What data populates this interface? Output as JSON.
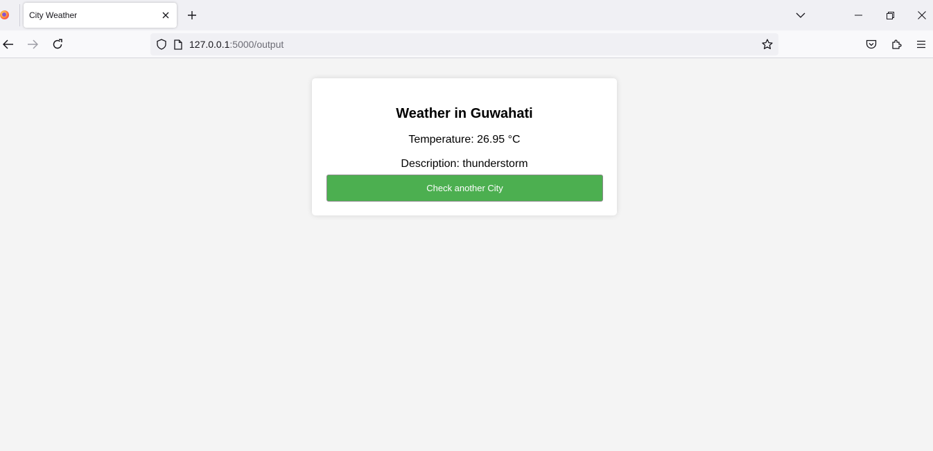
{
  "browser": {
    "tab_title": "City Weather",
    "url_host": "127.0.0.1",
    "url_path": ":5000/output"
  },
  "page": {
    "heading": "Weather in Guwahati",
    "temperature_text": "Temperature: 26.95 °C",
    "description_text": "Description: thunderstorm",
    "button_label": "Check another City"
  },
  "colors": {
    "button_bg": "#4caf50",
    "page_bg": "#f4f4f4",
    "card_bg": "#ffffff"
  },
  "icons": [
    "firefox-icon",
    "close-icon",
    "plus-icon",
    "chevron-down-icon",
    "minimize-icon",
    "restore-icon",
    "window-close-icon",
    "back-icon",
    "forward-icon",
    "reload-icon",
    "shield-icon",
    "page-icon",
    "star-icon",
    "pocket-icon",
    "extensions-icon",
    "menu-icon"
  ]
}
